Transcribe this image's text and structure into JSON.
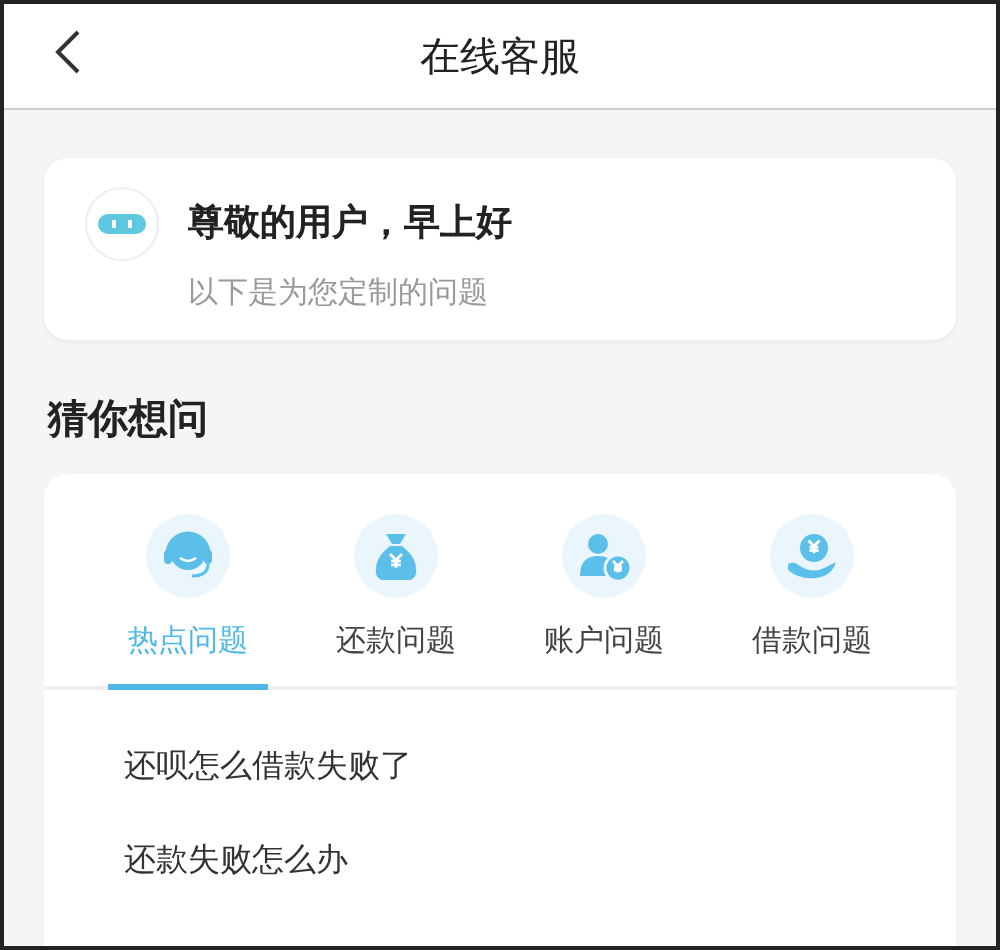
{
  "header": {
    "title": "在线客服"
  },
  "greeting": {
    "title": "尊敬的用户，早上好",
    "subtitle": "以下是为您定制的问题"
  },
  "section_title": "猜你想问",
  "tabs": [
    {
      "kind": "hot",
      "label": "热点问题",
      "selected": true
    },
    {
      "kind": "repay",
      "label": "还款问题",
      "selected": false
    },
    {
      "kind": "account",
      "label": "账户问题",
      "selected": false
    },
    {
      "kind": "loan",
      "label": "借款问题",
      "selected": false
    }
  ],
  "questions": [
    "还呗怎么借款失败了",
    "还款失败怎么办"
  ]
}
